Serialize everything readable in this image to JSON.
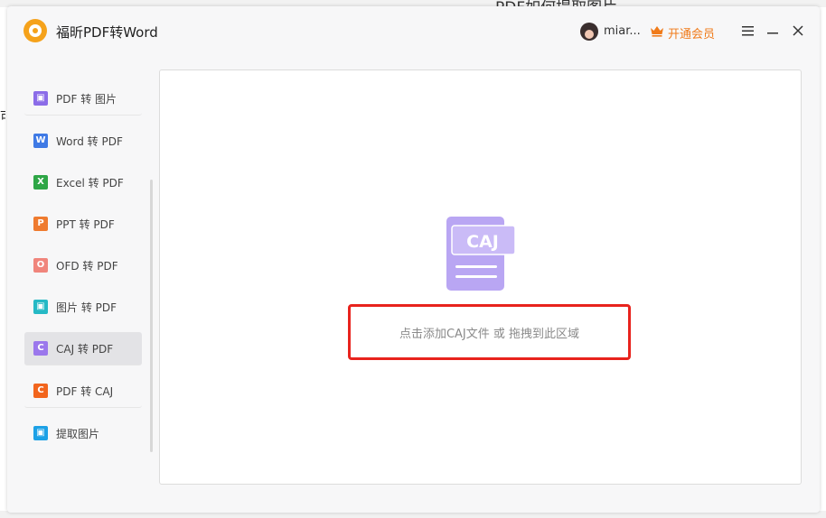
{
  "background": {
    "ghost_title": "PDF如何提取图片",
    "ghost_char": "可"
  },
  "window": {
    "title": "福昕PDF转Word",
    "user": {
      "name": "miar..."
    },
    "vip": {
      "label": "开通会员",
      "color": "#f07b1a"
    }
  },
  "sidebar": {
    "items": [
      {
        "label": "PDF 转 图片",
        "icon": "pdf-to-image-icon",
        "color": "#8b6ce8",
        "glyph": "▣"
      },
      {
        "label": "Word 转 PDF",
        "icon": "word-icon",
        "color": "#3f7ae5",
        "glyph": "W"
      },
      {
        "label": "Excel 转 PDF",
        "icon": "excel-icon",
        "color": "#2ea646",
        "glyph": "X"
      },
      {
        "label": "PPT 转 PDF",
        "icon": "ppt-icon",
        "color": "#ef7b2f",
        "glyph": "P"
      },
      {
        "label": "OFD 转 PDF",
        "icon": "ofd-icon",
        "color": "#f0857c",
        "glyph": "O"
      },
      {
        "label": "图片 转 PDF",
        "icon": "image-to-pdf-icon",
        "color": "#25b9c5",
        "glyph": "▣"
      },
      {
        "label": "CAJ 转 PDF",
        "icon": "caj-icon",
        "color": "#9b77ec",
        "glyph": "C",
        "active": true
      },
      {
        "label": "PDF 转 CAJ",
        "icon": "pdf-to-caj-icon",
        "color": "#f2651d",
        "glyph": "C"
      },
      {
        "label": "提取图片",
        "icon": "extract-image-icon",
        "color": "#1da1e6",
        "glyph": "▣"
      }
    ]
  },
  "main": {
    "illustration_text": "CAJ",
    "drop_text": "点击添加CAJ文件 或 拖拽到此区域",
    "highlight_color": "#e8231d"
  }
}
